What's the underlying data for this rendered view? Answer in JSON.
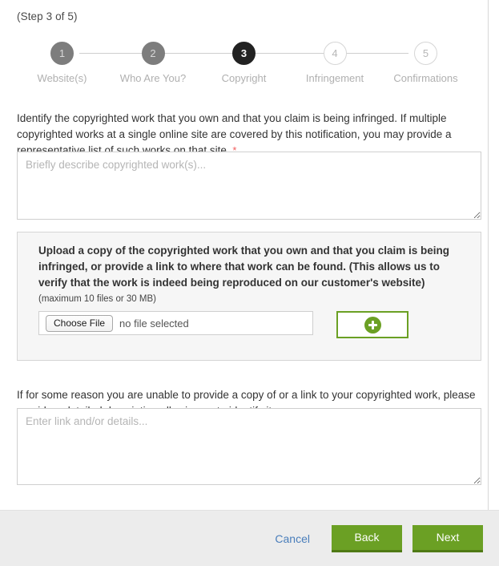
{
  "wizard": {
    "step_counter": "(Step 3 of 5)",
    "steps": [
      {
        "number": "1",
        "label": "Website(s)",
        "state": "done"
      },
      {
        "number": "2",
        "label": "Who Are You?",
        "state": "done"
      },
      {
        "number": "3",
        "label": "Copyright",
        "state": "current"
      },
      {
        "number": "4",
        "label": "Infringement",
        "state": "todo"
      },
      {
        "number": "5",
        "label": "Confirmations",
        "state": "todo"
      }
    ]
  },
  "intro": {
    "text": "Identify the copyrighted work that you own and that you claim is being infringed. If multiple copyrighted works at a single online site are covered by this notification, you may provide a representative list of such works on that site.",
    "required_marker": "*"
  },
  "work_description": {
    "placeholder": "Briefly describe copyrighted work(s)...",
    "value": ""
  },
  "upload": {
    "heading": "Upload a copy of the copyrighted work that you own and that you claim is being infringed, or provide a link to where that work can be found. (This allows us to verify that the work is indeed being reproduced on our customer's website)",
    "limit_note": "(maximum 10 files or 30 MB)",
    "choose_file_label": "Choose File",
    "file_status": "no file selected",
    "add_button_icon": "plus-circle-icon"
  },
  "fallback": {
    "text": "If for some reason you are unable to provide a copy of or a link to your copyrighted work, please provide a detailed description allowing us to identify it."
  },
  "link_details": {
    "placeholder": "Enter link and/or details...",
    "value": ""
  },
  "footer": {
    "cancel_label": "Cancel",
    "back_label": "Back",
    "next_label": "Next"
  },
  "colors": {
    "brand_green": "#6ba024",
    "brand_green_dark": "#4f7a14",
    "link_blue": "#4a7ebb",
    "required_red": "#f25c5c",
    "current_step": "#222222",
    "done_step": "#7d7d7d",
    "footer_bg": "#ececec",
    "panel_bg": "#f6f6f6"
  }
}
